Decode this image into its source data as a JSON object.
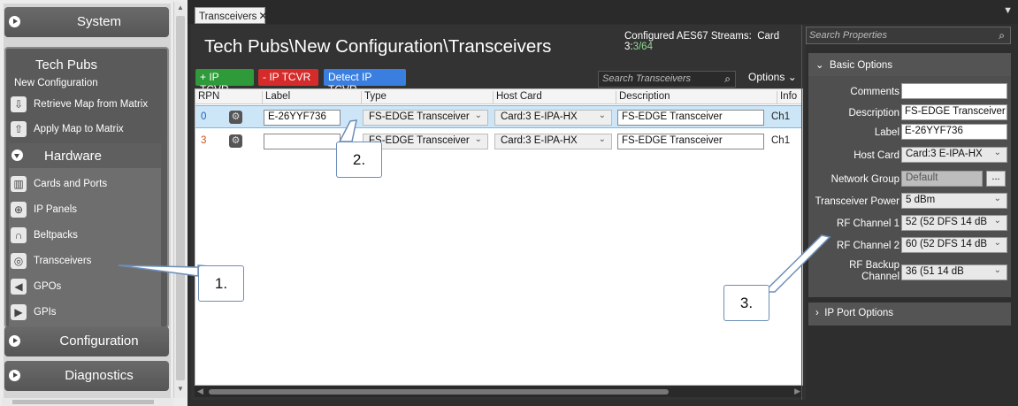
{
  "nav": {
    "system_label": "System",
    "project_title": "Tech Pubs",
    "project_subtitle": "New Configuration",
    "retrieve_label": "Retrieve Map from Matrix",
    "apply_label": "Apply Map to Matrix",
    "hardware_label": "Hardware",
    "hardware_items": [
      {
        "label": "Cards and Ports",
        "icon": "cards-ports-icon"
      },
      {
        "label": "IP Panels",
        "icon": "ip-panel-icon"
      },
      {
        "label": "Beltpacks",
        "icon": "beltpack-icon"
      },
      {
        "label": "Transceivers",
        "icon": "transceiver-icon"
      },
      {
        "label": "GPOs",
        "icon": "gpo-icon"
      },
      {
        "label": "GPIs",
        "icon": "gpi-icon"
      }
    ],
    "configuration_label": "Configuration",
    "diagnostics_label": "Diagnostics"
  },
  "tabs": [
    {
      "label": "Transceivers"
    }
  ],
  "page": {
    "title": "Tech Pubs\\New Configuration\\Transceivers",
    "streams_label": "Configured AES67 Streams:",
    "streams_card": "Card 3:",
    "streams_count": "3/64",
    "add_button": "+ IP TCVR",
    "remove_button": "- IP TCVR",
    "detect_button": "Detect IP TCVR",
    "search_placeholder": "Search Transceivers",
    "options_label": "Options"
  },
  "grid": {
    "columns": [
      "RPN",
      "Label",
      "Type",
      "Host Card",
      "Description",
      "Info"
    ],
    "rows": [
      {
        "rpn": "0",
        "label": "E-26YYF736",
        "type": "FS-EDGE Transceiver",
        "host_card": "Card:3 E-IPA-HX",
        "description": "FS-EDGE Transceiver",
        "info": "Ch1",
        "selected": true
      },
      {
        "rpn": "3",
        "label": "",
        "type": "FS-EDGE Transceiver",
        "host_card": "Card:3 E-IPA-HX",
        "description": "FS-EDGE Transceiver",
        "info": "Ch1",
        "selected": false
      }
    ]
  },
  "props": {
    "search_placeholder": "Search Properties",
    "basic_header": "Basic Options",
    "comments_label": "Comments",
    "comments_value": "",
    "description_label": "Description",
    "description_value": "FS-EDGE Transceiver",
    "label_label": "Label",
    "label_value": "E-26YYF736",
    "host_card_label": "Host Card",
    "host_card_value": "Card:3 E-IPA-HX",
    "network_group_label": "Network Group",
    "network_group_value": "Default",
    "network_group_button": "...",
    "power_label": "Transceiver Power",
    "power_value": "5 dBm",
    "rf1_label": "RF Channel 1",
    "rf1_value": "52 (52 DFS 14 dB",
    "rf2_label": "RF Channel 2",
    "rf2_value": "60 (52 DFS 14 dB",
    "rfbackup_label_line1": "RF Backup",
    "rfbackup_label_line2": "Channel",
    "rfbackup_value": "36 (51  14 dB",
    "ipport_header": "IP Port Options"
  },
  "callouts": [
    "1.",
    "2.",
    "3."
  ],
  "colors": {
    "add": "#2e9a3a",
    "remove": "#d52b2b",
    "detect": "#3a7fe0",
    "streams_count": "#8fd88f",
    "selected_row": "#cde6f7"
  }
}
